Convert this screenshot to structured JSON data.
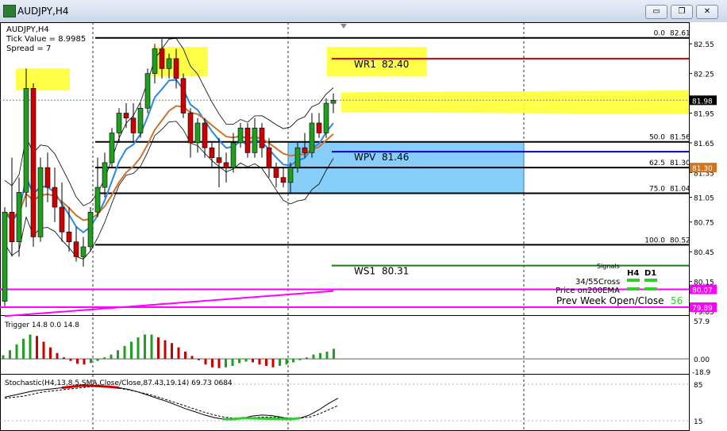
{
  "window": {
    "title": "AUDJPY,H4",
    "buttons": {
      "minimize": "▭",
      "restore": "❐",
      "close": "✕"
    }
  },
  "chart_data": {
    "type": "candlestick",
    "symbol": "AUDJPY",
    "timeframe": "H4",
    "info": [
      "AUDJPY,H4",
      "Tick Value = 8.9985",
      "Spread = 7"
    ],
    "ylim": [
      79.85,
      82.72
    ],
    "y_ticks": [
      82.55,
      82.25,
      81.85,
      81.55,
      81.25,
      81.0,
      80.75,
      80.45,
      80.15,
      79.85
    ],
    "y_tick_labels": [
      "82.55",
      "82.25",
      "81.95",
      "81.65",
      "81.35",
      "81.05",
      "80.75",
      "80.45",
      "80.15",
      "79.85"
    ],
    "candles": [
      {
        "o": 79.95,
        "h": 80.9,
        "l": 79.9,
        "c": 80.85
      },
      {
        "o": 80.85,
        "h": 81.4,
        "l": 80.4,
        "c": 80.55
      },
      {
        "o": 80.55,
        "h": 81.2,
        "l": 80.4,
        "c": 81.05
      },
      {
        "o": 81.05,
        "h": 82.3,
        "l": 80.9,
        "c": 82.1
      },
      {
        "o": 82.1,
        "h": 82.15,
        "l": 80.5,
        "c": 80.6
      },
      {
        "o": 80.6,
        "h": 81.4,
        "l": 80.55,
        "c": 81.3
      },
      {
        "o": 81.3,
        "h": 81.45,
        "l": 80.95,
        "c": 81.1
      },
      {
        "o": 81.1,
        "h": 81.3,
        "l": 80.75,
        "c": 80.9
      },
      {
        "o": 80.9,
        "h": 81.15,
        "l": 80.55,
        "c": 80.65
      },
      {
        "o": 80.65,
        "h": 80.9,
        "l": 80.45,
        "c": 80.55
      },
      {
        "o": 80.55,
        "h": 80.7,
        "l": 80.35,
        "c": 80.4
      },
      {
        "o": 80.4,
        "h": 80.6,
        "l": 80.3,
        "c": 80.5
      },
      {
        "o": 80.5,
        "h": 80.9,
        "l": 80.45,
        "c": 80.85
      },
      {
        "o": 80.85,
        "h": 81.4,
        "l": 80.8,
        "c": 81.1
      },
      {
        "o": 81.1,
        "h": 81.45,
        "l": 81.0,
        "c": 81.35
      },
      {
        "o": 81.35,
        "h": 81.7,
        "l": 81.3,
        "c": 81.65
      },
      {
        "o": 81.65,
        "h": 81.9,
        "l": 81.55,
        "c": 81.85
      },
      {
        "o": 81.85,
        "h": 81.95,
        "l": 81.7,
        "c": 81.8
      },
      {
        "o": 81.8,
        "h": 81.95,
        "l": 81.55,
        "c": 81.65
      },
      {
        "o": 81.65,
        "h": 81.95,
        "l": 81.6,
        "c": 81.9
      },
      {
        "o": 81.9,
        "h": 82.3,
        "l": 81.85,
        "c": 82.25
      },
      {
        "o": 82.25,
        "h": 82.55,
        "l": 82.15,
        "c": 82.5
      },
      {
        "o": 82.5,
        "h": 82.6,
        "l": 82.2,
        "c": 82.3
      },
      {
        "o": 82.3,
        "h": 82.45,
        "l": 82.2,
        "c": 82.4
      },
      {
        "o": 82.4,
        "h": 82.5,
        "l": 82.1,
        "c": 82.2
      },
      {
        "o": 82.2,
        "h": 82.25,
        "l": 81.8,
        "c": 81.85
      },
      {
        "o": 81.85,
        "h": 81.9,
        "l": 81.4,
        "c": 81.55
      },
      {
        "o": 81.55,
        "h": 81.8,
        "l": 81.45,
        "c": 81.75
      },
      {
        "o": 81.75,
        "h": 81.8,
        "l": 81.4,
        "c": 81.5
      },
      {
        "o": 81.5,
        "h": 81.55,
        "l": 81.3,
        "c": 81.4
      },
      {
        "o": 81.4,
        "h": 81.6,
        "l": 81.1,
        "c": 81.35
      },
      {
        "o": 81.35,
        "h": 81.45,
        "l": 81.15,
        "c": 81.3
      },
      {
        "o": 81.3,
        "h": 81.65,
        "l": 81.25,
        "c": 81.55
      },
      {
        "o": 81.55,
        "h": 81.75,
        "l": 81.5,
        "c": 81.7
      },
      {
        "o": 81.7,
        "h": 81.75,
        "l": 81.4,
        "c": 81.45
      },
      {
        "o": 81.45,
        "h": 81.8,
        "l": 81.4,
        "c": 81.7
      },
      {
        "o": 81.7,
        "h": 81.75,
        "l": 81.4,
        "c": 81.5
      },
      {
        "o": 81.5,
        "h": 81.6,
        "l": 81.2,
        "c": 81.3
      },
      {
        "o": 81.3,
        "h": 81.35,
        "l": 81.1,
        "c": 81.2
      },
      {
        "o": 81.2,
        "h": 81.3,
        "l": 81.1,
        "c": 81.15
      },
      {
        "o": 81.15,
        "h": 81.35,
        "l": 81.05,
        "c": 81.3
      },
      {
        "o": 81.3,
        "h": 81.55,
        "l": 81.25,
        "c": 81.5
      },
      {
        "o": 81.5,
        "h": 81.65,
        "l": 81.4,
        "c": 81.45
      },
      {
        "o": 81.45,
        "h": 81.85,
        "l": 81.4,
        "c": 81.75
      },
      {
        "o": 81.75,
        "h": 81.85,
        "l": 81.6,
        "c": 81.65
      },
      {
        "o": 81.65,
        "h": 82.0,
        "l": 81.6,
        "c": 81.95
      },
      {
        "o": 81.95,
        "h": 82.05,
        "l": 81.85,
        "c": 81.98
      }
    ],
    "fib_levels": [
      {
        "label": "0.0",
        "value": 82.61,
        "value_label": "82.61"
      },
      {
        "label": "50.0",
        "value": 81.56,
        "value_label": "81.56"
      },
      {
        "label": "62.5",
        "value": 81.3,
        "value_label": "81.30"
      },
      {
        "label": "75.0",
        "value": 81.04,
        "value_label": "81.04"
      },
      {
        "label": "100.0",
        "value": 80.52,
        "value_label": "80.52"
      }
    ],
    "pivots": [
      {
        "name": "WR1",
        "value": 82.4,
        "value_label": "82.40",
        "color": "#cc0000"
      },
      {
        "name": "WPV",
        "value": 81.46,
        "value_label": "81.46",
        "color": "#0000cc"
      },
      {
        "name": "WS1",
        "value": 80.31,
        "value_label": "80.31",
        "color": "#1b7a1b"
      }
    ],
    "moving_average_label": "81.30",
    "magenta_levels": [
      {
        "value": 80.07,
        "value_label": "80.07"
      },
      {
        "value": 79.89,
        "value_label": "79.89"
      }
    ],
    "current_price": {
      "value": 81.98,
      "label": "81.98"
    },
    "signals": {
      "title": "Signals",
      "columns": [
        "H4",
        "D1"
      ],
      "rows": [
        "34/55Cross",
        "Price on200EMA"
      ],
      "prev_week_label": "Prev Week Open/Close",
      "prev_week_value": "56"
    },
    "trigger": {
      "label": "Trigger 14.8 0.0 14.8",
      "ylim": [
        -18.9,
        57.9
      ],
      "tick_labels": [
        "57.9",
        "0.00",
        "-18.9"
      ],
      "values": [
        5,
        12,
        20,
        28,
        34,
        32,
        24,
        16,
        8,
        2,
        -3,
        -7,
        -8,
        -6,
        -3,
        2,
        6,
        12,
        18,
        24,
        30,
        34,
        34,
        30,
        26,
        22,
        16,
        10,
        4,
        -2,
        -8,
        -12,
        -13,
        -12,
        -10,
        -6,
        -4,
        -5,
        -8,
        -10,
        -12,
        -10,
        -8,
        -5,
        -2,
        2,
        6,
        8,
        10,
        14
      ]
    },
    "stochastic": {
      "label": "Stochastic(H4,13,8,5,SMA,Close/Close,87.43,19.14) 69.73 0684",
      "ylim": [
        0,
        100
      ],
      "tick_labels": [
        "85",
        "15"
      ],
      "main": [
        60,
        64,
        68,
        72,
        74,
        76,
        78,
        80,
        82,
        82,
        81,
        80,
        78,
        75,
        70,
        64,
        58,
        52,
        45,
        38,
        32,
        26,
        21,
        18,
        18,
        20,
        24,
        26,
        25,
        22,
        18,
        20,
        26,
        36,
        48,
        58
      ],
      "signal": [
        58,
        60,
        62,
        66,
        70,
        72,
        74,
        76,
        78,
        80,
        80,
        79,
        77,
        74,
        70,
        66,
        61,
        55,
        49,
        43,
        37,
        31,
        26,
        22,
        20,
        20,
        21,
        22,
        22,
        21,
        20,
        20,
        22,
        28,
        36,
        44
      ]
    }
  }
}
